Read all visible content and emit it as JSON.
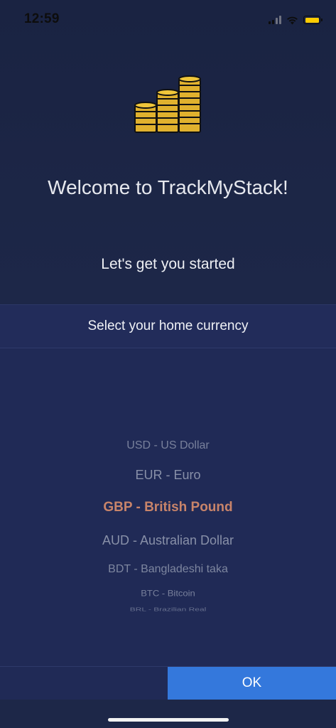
{
  "status_bar": {
    "time": "12:59",
    "battery_color": "#ffcc00"
  },
  "welcome": {
    "logo_icon": "coin-stacks-icon",
    "title": "Welcome to TrackMyStack!",
    "subtitle": "Let's get you started"
  },
  "currency_picker": {
    "header": "Select your home currency",
    "options": [
      "USD - US Dollar",
      "EUR - Euro",
      "GBP - British Pound",
      "AUD - Australian Dollar",
      "BDT - Bangladeshi taka",
      "BTC - Bitcoin",
      "BRL - Brazilian Real"
    ],
    "selected": "GBP - British Pound",
    "ok_label": "OK"
  },
  "colors": {
    "background": "#1d2748",
    "selected_text": "#c8846a",
    "ok_button": "#3478dc"
  }
}
